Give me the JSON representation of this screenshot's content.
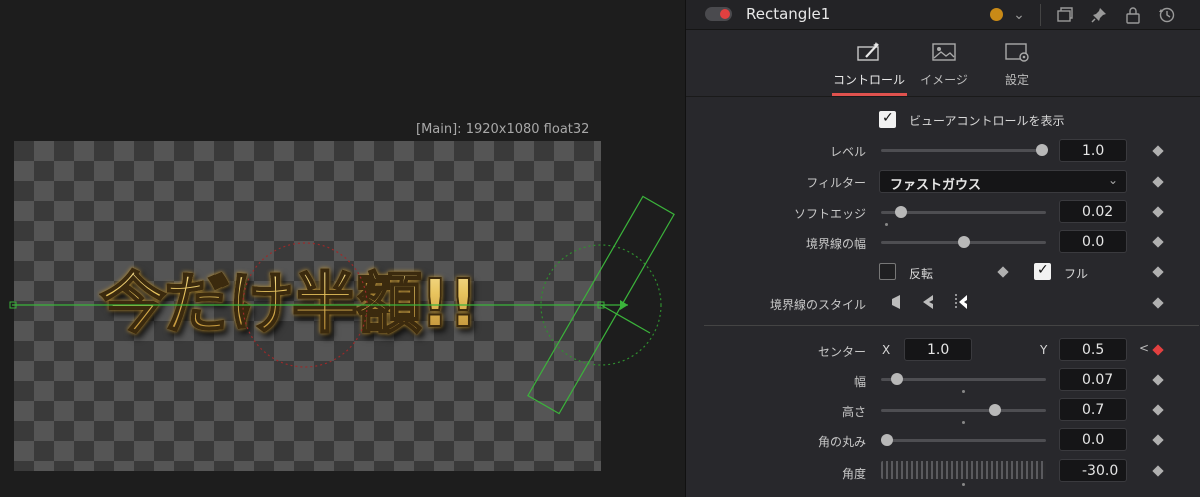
{
  "viewer": {
    "info": "[Main]: 1920x1080 float32",
    "headline": "今だけ半額!!"
  },
  "header": {
    "node_name": "Rectangle1",
    "icons": [
      "color-swatch-icon",
      "chevron-down-icon",
      "view-toggle-icon",
      "pin-icon",
      "lock-icon",
      "reset-icon"
    ],
    "colors": {
      "toggle_on": "#e24040",
      "node_color": "#c98a17",
      "accent": "#e0524e"
    }
  },
  "tabs": [
    {
      "label": "コントロール",
      "icon": "wand-icon",
      "active": true
    },
    {
      "label": "イメージ",
      "icon": "image-icon",
      "active": false
    },
    {
      "label": "設定",
      "icon": "settings-icon",
      "active": false
    }
  ],
  "controls": {
    "show_view_controls": {
      "label": "ビューアコントロールを表示",
      "checked": true
    },
    "level": {
      "label": "レベル",
      "value": "1.0",
      "slider": 1.0
    },
    "filter": {
      "label": "フィルター",
      "value": "ファストガウス"
    },
    "soft_edge": {
      "label": "ソフトエッジ",
      "value": "0.02",
      "slider": 0.1
    },
    "border_width": {
      "label": "境界線の幅",
      "value": "0.0",
      "slider": 0.5
    },
    "invert": {
      "label": "反転",
      "checked": false
    },
    "full": {
      "label": "フル",
      "checked": true
    },
    "border_style": {
      "label": "境界線のスタイル"
    },
    "center": {
      "label": "センター",
      "x_label": "X",
      "x": "1.0",
      "y_label": "Y",
      "y": "0.5"
    },
    "width": {
      "label": "幅",
      "value": "0.07",
      "slider": 0.1
    },
    "height": {
      "label": "高さ",
      "value": "0.7",
      "slider": 0.7
    },
    "corner_radius": {
      "label": "角の丸み",
      "value": "0.0",
      "slider": 0.0
    },
    "angle": {
      "label": "角度",
      "value": "-30.0"
    }
  }
}
